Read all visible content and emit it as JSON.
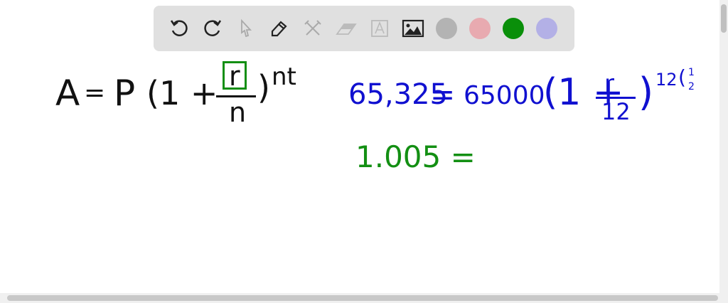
{
  "toolbar": {
    "tools": [
      "undo-icon",
      "redo-icon",
      "select-icon",
      "pen-icon",
      "tools-icon",
      "eraser-icon",
      "text-icon",
      "image-icon"
    ],
    "colors": [
      "#b3b3b3",
      "#e8aab0",
      "#0a8f0a",
      "#b3b0e6"
    ]
  },
  "canvas": {
    "formula": {
      "lhs": "A",
      "eq": "=",
      "p": "P",
      "open": "(1 +",
      "num": "r",
      "den": "n",
      "close": ")",
      "exp": "nt"
    },
    "line2": {
      "lhs": "65,325",
      "eq": "=",
      "p": "65000",
      "open": "(1 +",
      "num": "r",
      "den": "12",
      "close": ")",
      "exp": "12",
      "exp_num": "1",
      "exp_den": "2"
    },
    "line3": {
      "text": "1.005 ="
    }
  }
}
